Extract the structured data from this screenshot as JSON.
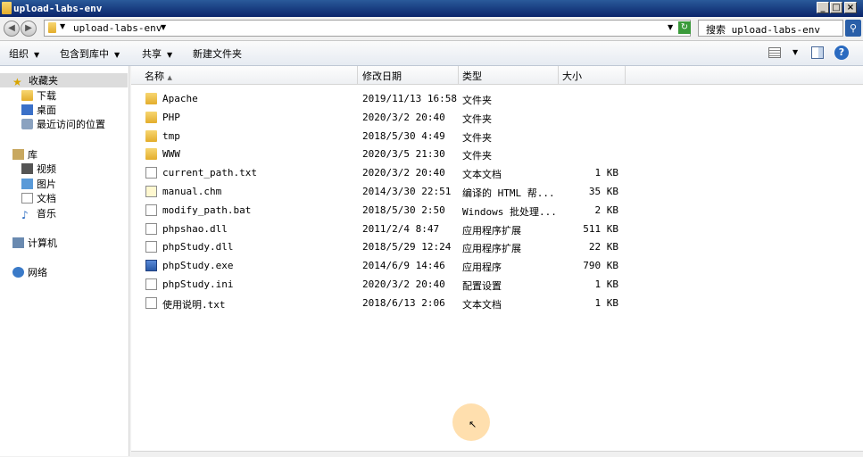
{
  "window": {
    "title": "upload-labs-env"
  },
  "address": {
    "path": "upload-labs-env"
  },
  "search": {
    "placeholder": "搜索 upload-labs-env"
  },
  "toolbar": {
    "organize": "组织",
    "include_in_library": "包含到库中",
    "share": "共享",
    "new_folder": "新建文件夹"
  },
  "nav": {
    "favorites": "收藏夹",
    "downloads": "下载",
    "desktop": "桌面",
    "recent": "最近访问的位置",
    "libraries": "库",
    "videos": "视频",
    "pictures": "图片",
    "documents": "文档",
    "music": "音乐",
    "computer": "计算机",
    "network": "网络"
  },
  "columns": {
    "name": "名称",
    "modified": "修改日期",
    "type": "类型",
    "size": "大小"
  },
  "files": [
    {
      "name": "Apache",
      "date": "2019/11/13 16:58",
      "type": "文件夹",
      "size": "",
      "icon": "folder-icon"
    },
    {
      "name": "PHP",
      "date": "2020/3/2 20:40",
      "type": "文件夹",
      "size": "",
      "icon": "folder-icon"
    },
    {
      "name": "tmp",
      "date": "2018/5/30 4:49",
      "type": "文件夹",
      "size": "",
      "icon": "folder-icon"
    },
    {
      "name": "WWW",
      "date": "2020/3/5 21:30",
      "type": "文件夹",
      "size": "",
      "icon": "folder-icon"
    },
    {
      "name": "current_path.txt",
      "date": "2020/3/2 20:40",
      "type": "文本文档",
      "size": "1 KB",
      "icon": "text-file-icon"
    },
    {
      "name": "manual.chm",
      "date": "2014/3/30 22:51",
      "type": "编译的 HTML 帮...",
      "size": "35 KB",
      "icon": "help-file-icon"
    },
    {
      "name": "modify_path.bat",
      "date": "2018/5/30 2:50",
      "type": "Windows 批处理...",
      "size": "2 KB",
      "icon": "batch-file-icon"
    },
    {
      "name": "phpshao.dll",
      "date": "2011/2/4 8:47",
      "type": "应用程序扩展",
      "size": "511 KB",
      "icon": "dll-file-icon"
    },
    {
      "name": "phpStudy.dll",
      "date": "2018/5/29 12:24",
      "type": "应用程序扩展",
      "size": "22 KB",
      "icon": "dll-file-icon"
    },
    {
      "name": "phpStudy.exe",
      "date": "2014/6/9 14:46",
      "type": "应用程序",
      "size": "790 KB",
      "icon": "exe-file-icon"
    },
    {
      "name": "phpStudy.ini",
      "date": "2020/3/2 20:40",
      "type": "配置设置",
      "size": "1 KB",
      "icon": "ini-file-icon"
    },
    {
      "name": "使用说明.txt",
      "date": "2018/6/13 2:06",
      "type": "文本文档",
      "size": "1 KB",
      "icon": "text-file-icon"
    }
  ]
}
